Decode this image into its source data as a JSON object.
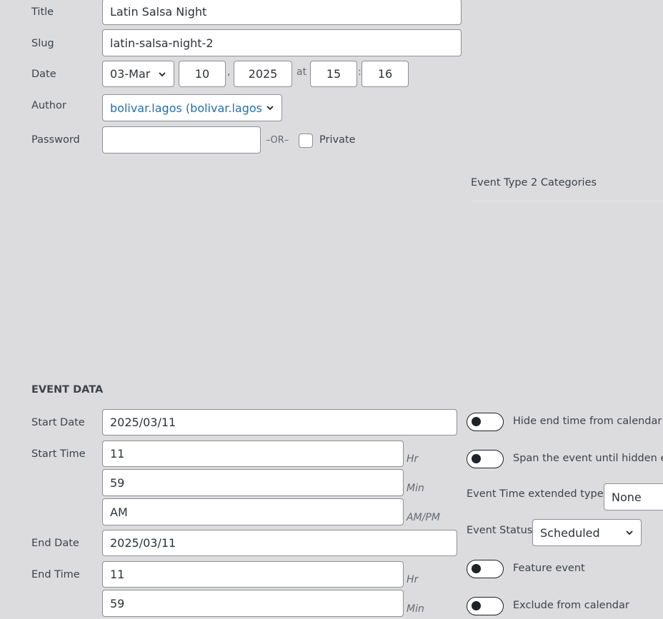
{
  "quick_edit": {
    "title_label": "Title",
    "title_value": "Latin Salsa Night",
    "slug_label": "Slug",
    "slug_value": "latin-salsa-night-2",
    "date_label": "Date",
    "date_month": "03-Mar",
    "date_day": "10",
    "date_sep_comma": ",",
    "date_year": "2025",
    "date_at": "at",
    "date_hour": "15",
    "date_sep_colon": ":",
    "date_minute": "16",
    "author_label": "Author",
    "author_value": "bolivar.lagos (bolivar.lagos)",
    "password_label": "Password",
    "password_value": "",
    "or_text": "–OR–",
    "private_label": "Private"
  },
  "taxonomy": {
    "event_type_2_label": "Event Type 2 Categories"
  },
  "event_data": {
    "heading": "EVENT DATA",
    "start_date_label": "Start Date",
    "start_date_value": "2025/03/11",
    "start_time_label": "Start Time",
    "start_hour": "11",
    "start_min": "59",
    "start_ampm": "AM",
    "hr_unit": "Hr",
    "min_unit": "Min",
    "ampm_unit": "AM/PM",
    "end_date_label": "End Date",
    "end_date_value": "2025/03/11",
    "end_time_label": "End Time",
    "end_hour": "11",
    "end_min": "59",
    "hide_end_time_label": "Hide end time from calendar",
    "span_event_label": "Span the event until hidden e",
    "extended_type_label": "Event Time extended type",
    "extended_type_value": "None",
    "status_label": "Event Status",
    "status_value": "Scheduled",
    "feature_label": "Feature event",
    "exclude_label": "Exclude from calendar"
  },
  "icons": {
    "chevron": "chevron-down-icon"
  }
}
